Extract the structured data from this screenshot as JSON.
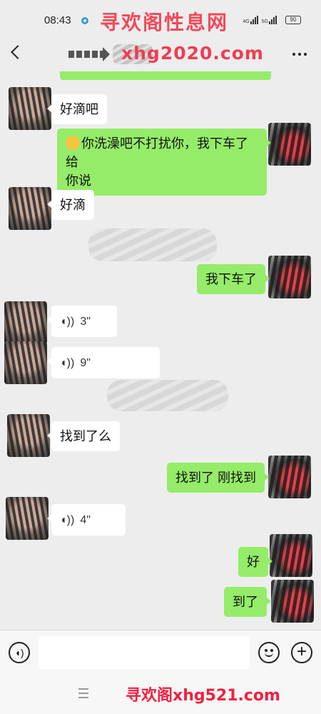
{
  "status_bar": {
    "time": "08:43",
    "signal_1": "4G",
    "signal_2": "5G",
    "battery": "90"
  },
  "watermarks": {
    "top": "寻欢阁性息网",
    "nav": "xhg2020.com",
    "bottom": "寻欢阁xhg521.com"
  },
  "colors": {
    "outgoing_bubble": "#95ec69",
    "incoming_bubble": "#ffffff",
    "background": "#ededed",
    "watermark": "#f24a5a"
  },
  "messages": [
    {
      "side": "left",
      "type": "text",
      "text": "好滴吧"
    },
    {
      "side": "right",
      "type": "text",
      "emoji": "smirk-face",
      "line1": "你洗澡吧不打扰你，我下车了给",
      "line2": "你说"
    },
    {
      "side": "left",
      "type": "text",
      "text": "好滴"
    },
    {
      "side": "right",
      "type": "text",
      "text": "我下车了"
    },
    {
      "side": "left",
      "type": "voice",
      "duration": "3\""
    },
    {
      "side": "left",
      "type": "voice",
      "duration": "9\""
    },
    {
      "side": "left",
      "type": "text",
      "text": "找到了么"
    },
    {
      "side": "right",
      "type": "text",
      "text": "找到了 刚找到"
    },
    {
      "side": "left",
      "type": "voice",
      "duration": "4\""
    },
    {
      "side": "right",
      "type": "text",
      "text": "好"
    },
    {
      "side": "right",
      "type": "text",
      "text": "到了"
    }
  ],
  "input_bar": {
    "voice_icon": "voice-icon",
    "emoji_icon": "emoji-icon",
    "plus_icon": "plus-icon",
    "placeholder": ""
  },
  "voice_glyph": "◖))"
}
